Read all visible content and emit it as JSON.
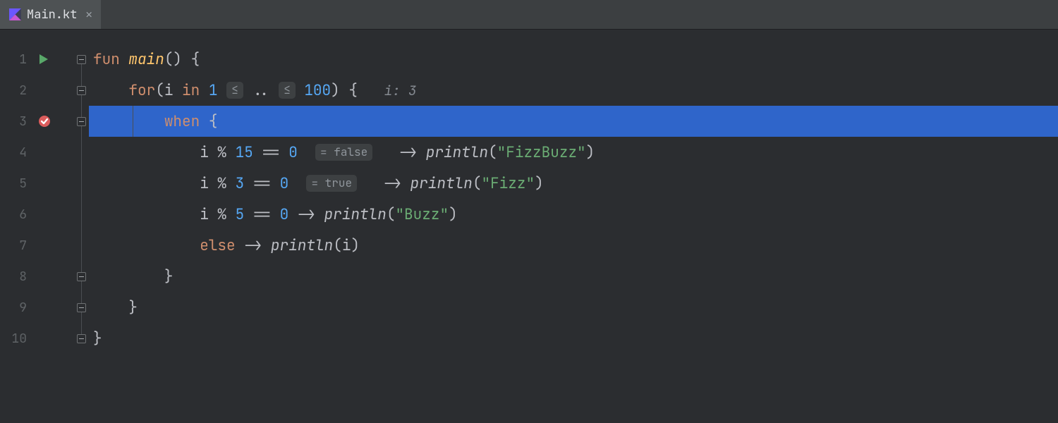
{
  "tab": {
    "filename": "Main.kt"
  },
  "gutter": {
    "lines": [
      "1",
      "2",
      "3",
      "4",
      "5",
      "6",
      "7",
      "8",
      "9",
      "10"
    ],
    "run_line": 1,
    "breakpoint_line": 3
  },
  "code": {
    "line1": {
      "kw_fun": "fun",
      "fn_main": "main",
      "parens": "()",
      "brace": " {"
    },
    "line2": {
      "kw_for": "for",
      "open": "(",
      "var": "i",
      "kw_in": "in",
      "start": "1",
      "le1": "≤",
      "range": "..",
      "le2": "≤",
      "end": "100",
      "close": ")",
      "brace": " {",
      "hint_label": "i:",
      "hint_value": "3"
    },
    "line3": {
      "kw_when": "when",
      "brace": " {"
    },
    "line4": {
      "lhs": "i % ",
      "n": "15",
      "eq": " == ",
      "z": "0",
      "inline": "= false",
      "arrow": " -> ",
      "fn": "println",
      "open": "(",
      "str": "\"FizzBuzz\"",
      "close": ")"
    },
    "line5": {
      "lhs": "i % ",
      "n": "3",
      "eq": " == ",
      "z": "0",
      "inline": "= true",
      "arrow": " -> ",
      "fn": "println",
      "open": "(",
      "str": "\"Fizz\"",
      "close": ")"
    },
    "line6": {
      "lhs": "i % ",
      "n": "5",
      "eq": " == ",
      "z": "0",
      "arrow": " -> ",
      "fn": "println",
      "open": "(",
      "str": "\"Buzz\"",
      "close": ")"
    },
    "line7": {
      "kw_else": "else",
      "arrow": " -> ",
      "fn": "println",
      "open": "(",
      "var": "i",
      "close": ")"
    },
    "line8": {
      "brace": "}"
    },
    "line9": {
      "brace": "}"
    },
    "line10": {
      "brace": "}"
    }
  }
}
